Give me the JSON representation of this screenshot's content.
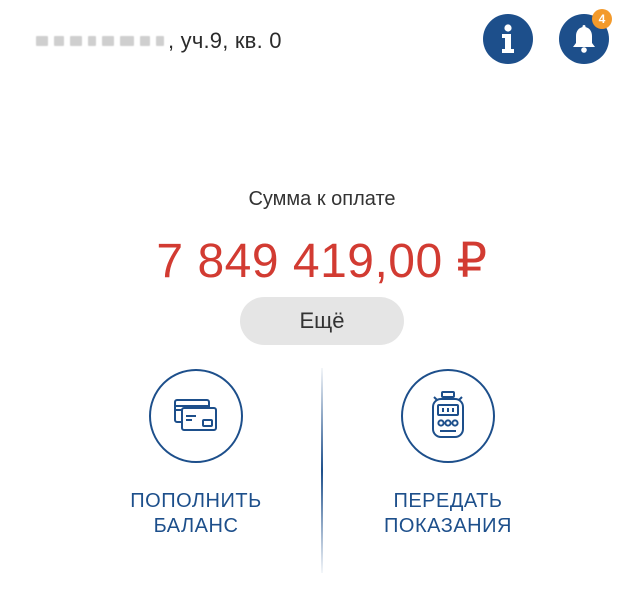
{
  "header": {
    "address_suffix": ", уч.9, кв. 0",
    "notifications_count": "4"
  },
  "balance": {
    "label": "Сумма к оплате",
    "amount": "7 849 419,00 ₽",
    "more_label": "Ещё"
  },
  "actions": [
    {
      "label_line1": "ПОПОЛНИТЬ",
      "label_line2": "БАЛАНС",
      "icon": "credit-card-icon"
    },
    {
      "label_line1": "ПЕРЕДАТЬ",
      "label_line2": "ПОКАЗАНИЯ",
      "icon": "meter-icon"
    }
  ],
  "colors": {
    "primary": "#1d4f8b",
    "amount": "#d23b32",
    "badge": "#f39a2b",
    "button_bg": "#e5e5e5"
  }
}
